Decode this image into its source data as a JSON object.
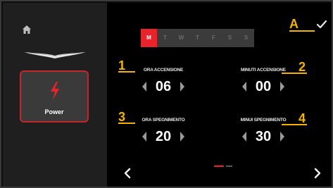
{
  "sidebar": {
    "home_icon": "home-icon",
    "logo_icon": "brand-wings-logo",
    "power_label": "Power",
    "power_icon": "lightning-bolt-icon",
    "accent_color": "#e8232b"
  },
  "days": [
    "M",
    "T",
    "W",
    "T",
    "F",
    "S",
    "S"
  ],
  "active_day_index": 0,
  "callouts": {
    "a": "A",
    "one": "1",
    "two": "2",
    "three": "3",
    "four": "4",
    "color": "#f2b400"
  },
  "settings": {
    "ora_accensione": {
      "label": "ORA ACCENSIONE",
      "value": "06"
    },
    "minuti_accensione": {
      "label": "MINUTI ACCENSIONE",
      "value": "00"
    },
    "ora_spegnimento": {
      "label": "ORA SPEGNIMENTO",
      "value": "20"
    },
    "minuti_spegnimento": {
      "label": "MINUI SPEGNIMENTO",
      "value": "30"
    }
  },
  "pager": {
    "pages": 2,
    "current": 1
  },
  "icons": {
    "confirm": "checkmark-icon",
    "prev": "chevron-left-icon",
    "next": "chevron-right-icon"
  }
}
